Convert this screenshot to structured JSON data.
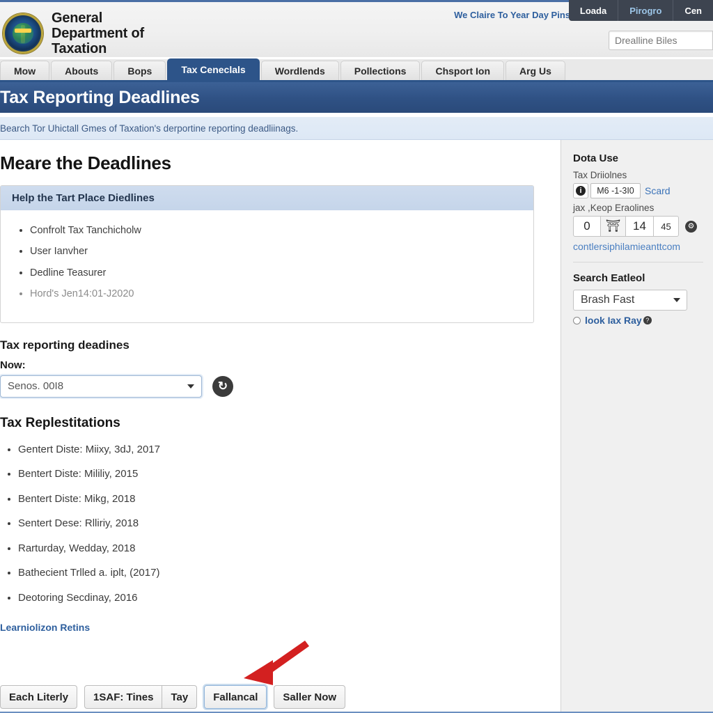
{
  "header": {
    "logo_lines": [
      "General",
      "Department of",
      "Taxation"
    ],
    "seal_icon": "government-seal-icon",
    "utility_link": "We Claire To Year Day Pins",
    "dark_tabs": [
      "Loada",
      "Pirogro",
      "Cen"
    ],
    "search_placeholder": "Drealline Biles",
    "search_value": ""
  },
  "nav": {
    "tabs": [
      {
        "label": "Mow",
        "active": false
      },
      {
        "label": "Abouts",
        "active": false
      },
      {
        "label": "Bops",
        "active": false
      },
      {
        "label": "Tax Ceneclals",
        "active": true
      },
      {
        "label": "Wordlends",
        "active": false
      },
      {
        "label": "Pollections",
        "active": false
      },
      {
        "label": "Chsport Ion",
        "active": false
      },
      {
        "label": "Arg Us",
        "active": false
      }
    ]
  },
  "banner": {
    "title": "Tax Reporting Deadlines"
  },
  "intro": {
    "text": "Bearch Tor Uhictall Gmes of Taxation's derportine reporting deadliinags."
  },
  "main": {
    "section_heading": "Meare the Deadlines",
    "panel": {
      "heading": "Help the Tart Place Diedlines",
      "items": [
        "Confrolt Tax Tanchicholw",
        "User Ianvher",
        "Dedline Teasurer",
        "Hord's Jen14:01-J2020"
      ],
      "muted_index": 3
    },
    "subheading": "Tax reporting deadines",
    "field_label": "Now:",
    "select_value": "Senos. 00I8",
    "refresh_icon": "refresh-icon",
    "list_heading": "Tax Replestitations",
    "dates": [
      "Gentert Diste: Miixy, 3dJ, 2017",
      "Bentert Diste: Mililiy, 2015",
      "Bentert Diste: Mikg, 2018",
      "Sentert Dese: Rlliriy, 2018",
      "Rarturday, Wedday, 2018",
      "Bathecient Trlled a. iplt, (2017)",
      "Deotoring Secdinay, 2016"
    ],
    "learn_link": "Learniolizon Retins",
    "buttons": {
      "first": "Each Literly",
      "group": [
        "1SAF: Tines",
        "Tay"
      ],
      "focused": "Fallancal",
      "last": "Saller Now"
    },
    "arrow_icon": "red-arrow-pointer"
  },
  "sidebar": {
    "title": "Dota Use",
    "label_1": "Tax Driiolnes",
    "info_icon": "info-icon",
    "chip_value": "M6 -1-3I0",
    "chip_link": "Scard",
    "label_2": "jax ,Keop Eraolines",
    "num_1": "0",
    "num_icon": "upload-icon",
    "num_2": "14",
    "num_3": "45",
    "gear_icon": "gear-icon",
    "email_link": "contlersiphilamieanttcom",
    "search_title": "Search Eatleol",
    "search_select_value": "Brash Fast",
    "radio_label": "look Iax Ray"
  },
  "colors": {
    "brand_blue": "#2d5489",
    "banner_blue": "#2f5184",
    "link_blue": "#2e5f9e",
    "panel_head": "#c5d5ea",
    "arrow_red": "#d32020",
    "sidebar_bg": "#f0f0f0"
  }
}
